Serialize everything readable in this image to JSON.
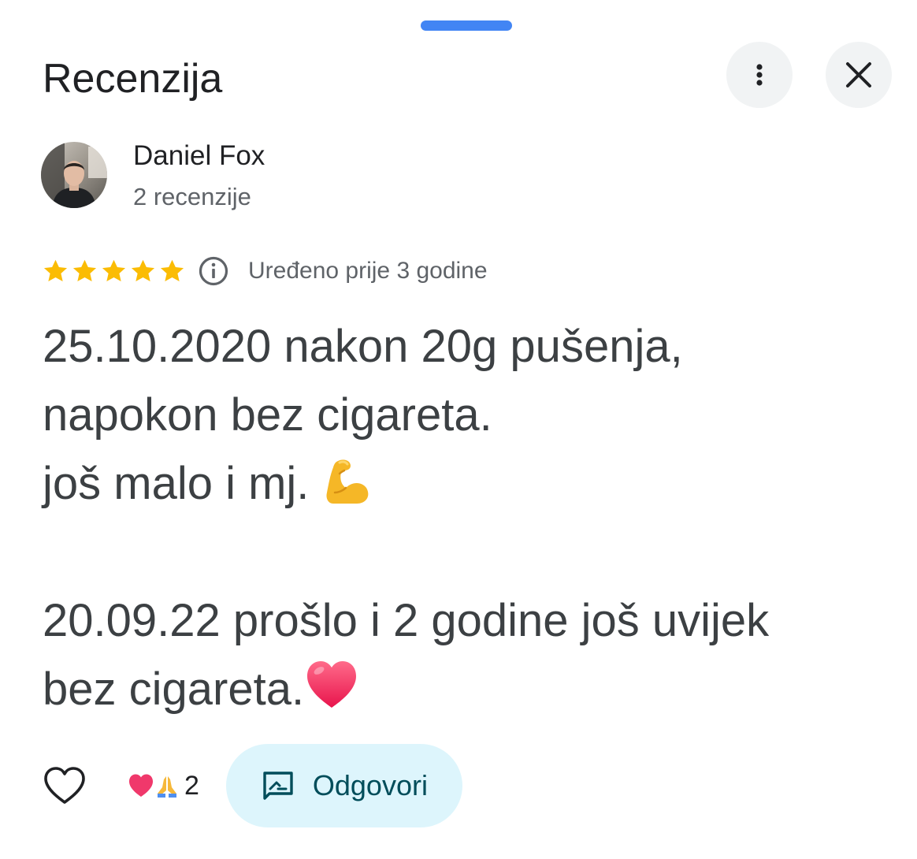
{
  "sheet": {
    "title": "Recenzija"
  },
  "header_actions": {
    "more_icon": "more-vert-icon",
    "close_icon": "close-icon"
  },
  "author": {
    "name": "Daniel Fox",
    "review_count": "2 recenzije"
  },
  "rating": {
    "stars": 5,
    "edited": "Uređeno prije 3 godine"
  },
  "review": {
    "text": "25.10.2020 nakon 20g pušenja,\nnapokon bez cigareta.\njoš malo i mj. ",
    "text_part2": "\n\n20.09.22 prošlo i 2 godine još uvijek\nbez cigareta."
  },
  "actions": {
    "reaction_count": "2",
    "reply_label": "Odgovori"
  },
  "colors": {
    "handle": "#4285f4",
    "star": "#fbbc04",
    "reply_bg": "#ddf5fc",
    "reply_text": "#004d5a"
  }
}
